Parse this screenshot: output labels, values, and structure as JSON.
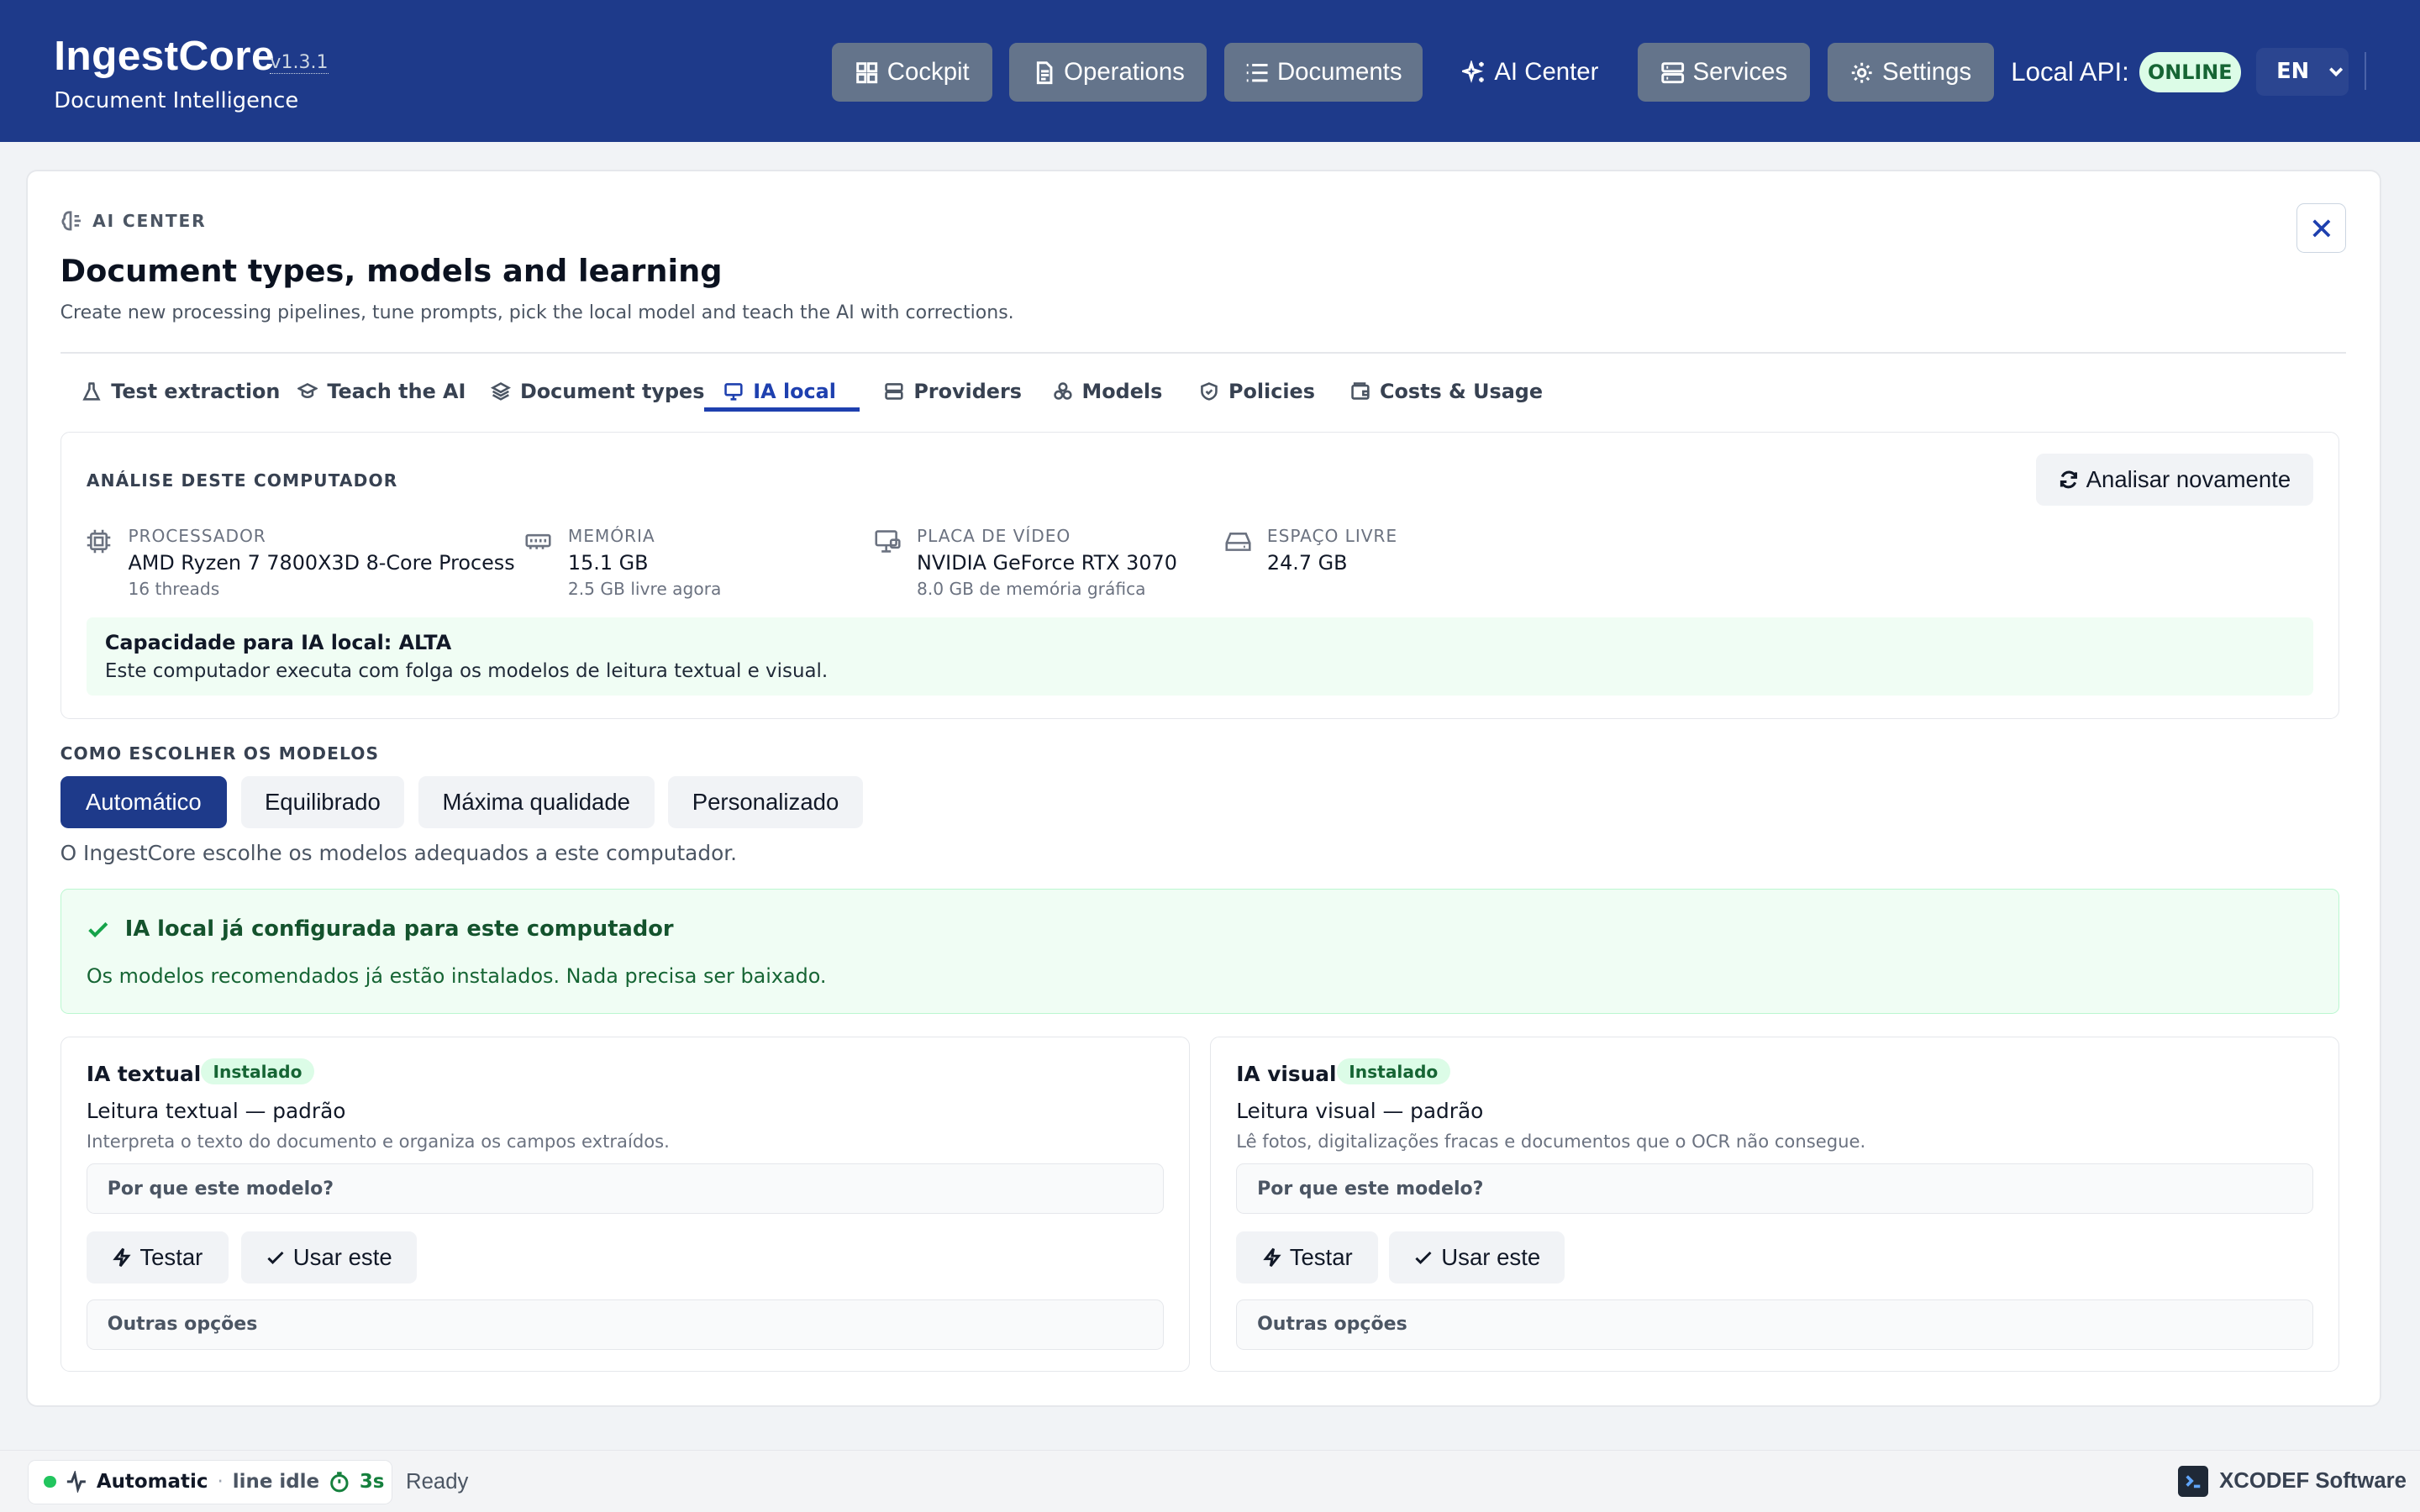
{
  "header": {
    "brand": "IngestCore",
    "version": "v1.3.1",
    "subtitle": "Document Intelligence",
    "nav": [
      {
        "label": "Cockpit",
        "icon": "grid-icon"
      },
      {
        "label": "Operations",
        "icon": "file-icon"
      },
      {
        "label": "Documents",
        "icon": "list-icon"
      },
      {
        "label": "AI Center",
        "icon": "sparkles-icon"
      },
      {
        "label": "Services",
        "icon": "server-icon"
      },
      {
        "label": "Settings",
        "icon": "gear-icon"
      }
    ],
    "api_label": "Local API:",
    "api_status": "ONLINE",
    "language": "EN"
  },
  "panel": {
    "eyebrow": "AI CENTER",
    "title": "Document types, models and learning",
    "description": "Create new processing pipelines, tune prompts, pick the local model and teach the AI with corrections.",
    "tabs": [
      {
        "label": "Test extraction",
        "icon": "flask-icon"
      },
      {
        "label": "Teach the AI",
        "icon": "graduation-cap-icon"
      },
      {
        "label": "Document types",
        "icon": "layers-icon"
      },
      {
        "label": "IA local",
        "icon": "monitor-icon",
        "active": true
      },
      {
        "label": "Providers",
        "icon": "server-icon"
      },
      {
        "label": "Models",
        "icon": "boxes-icon"
      },
      {
        "label": "Policies",
        "icon": "shield-icon"
      },
      {
        "label": "Costs & Usage",
        "icon": "wallet-icon"
      }
    ]
  },
  "analysis": {
    "heading": "ANÁLISE DESTE COMPUTADOR",
    "reanalyze_label": "Analisar novamente",
    "specs": [
      {
        "label": "PROCESSADOR",
        "value": "AMD Ryzen 7 7800X3D 8-Core Process",
        "sub": "16 threads",
        "icon": "cpu-icon"
      },
      {
        "label": "MEMÓRIA",
        "value": "15.1 GB",
        "sub": "2.5 GB livre agora",
        "icon": "memory-icon"
      },
      {
        "label": "PLACA DE VÍDEO",
        "value": "NVIDIA GeForce RTX 3070",
        "sub": "8.0 GB de memória gráfica",
        "icon": "gpu-monitor-icon"
      },
      {
        "label": "ESPAÇO LIVRE",
        "value": "24.7 GB",
        "sub": "",
        "icon": "drive-icon"
      }
    ],
    "capacity_title": "Capacidade para IA local: ALTA",
    "capacity_desc": "Este computador executa com folga os modelos de leitura textual e visual."
  },
  "mode": {
    "heading": "COMO ESCOLHER OS MODELOS",
    "options": [
      "Automático",
      "Equilibrado",
      "Máxima qualidade",
      "Personalizado"
    ],
    "selected": "Automático",
    "description": "O IngestCore escolhe os modelos adequados a este computador."
  },
  "success": {
    "title": "IA local já configurada para este computador",
    "description": "Os modelos recomendados já estão instalados. Nada precisa ser baixado."
  },
  "models": [
    {
      "title": "IA textual",
      "badge": "Instalado",
      "name": "Leitura textual — padrão",
      "description": "Interpreta o texto do documento e organiza os campos extraídos.",
      "why_label": "Por que este modelo?",
      "test_label": "Testar",
      "use_label": "Usar este",
      "other_label": "Outras opções"
    },
    {
      "title": "IA visual",
      "badge": "Instalado",
      "name": "Leitura visual — padrão",
      "description": "Lê fotos, digitalizações fracas e documentos que o OCR não consegue.",
      "why_label": "Por que este modelo?",
      "test_label": "Testar",
      "use_label": "Usar este",
      "other_label": "Outras opções"
    }
  ],
  "footer": {
    "mode": "Automatic",
    "sep": "·",
    "line_status": "line idle",
    "timer": "3s",
    "status": "Ready",
    "company": "XCODEF Software"
  },
  "colors": {
    "header_bg": "#1e3a8a",
    "accent": "#1e40af",
    "success_bg": "#f0fdf4",
    "online": "#166534"
  }
}
